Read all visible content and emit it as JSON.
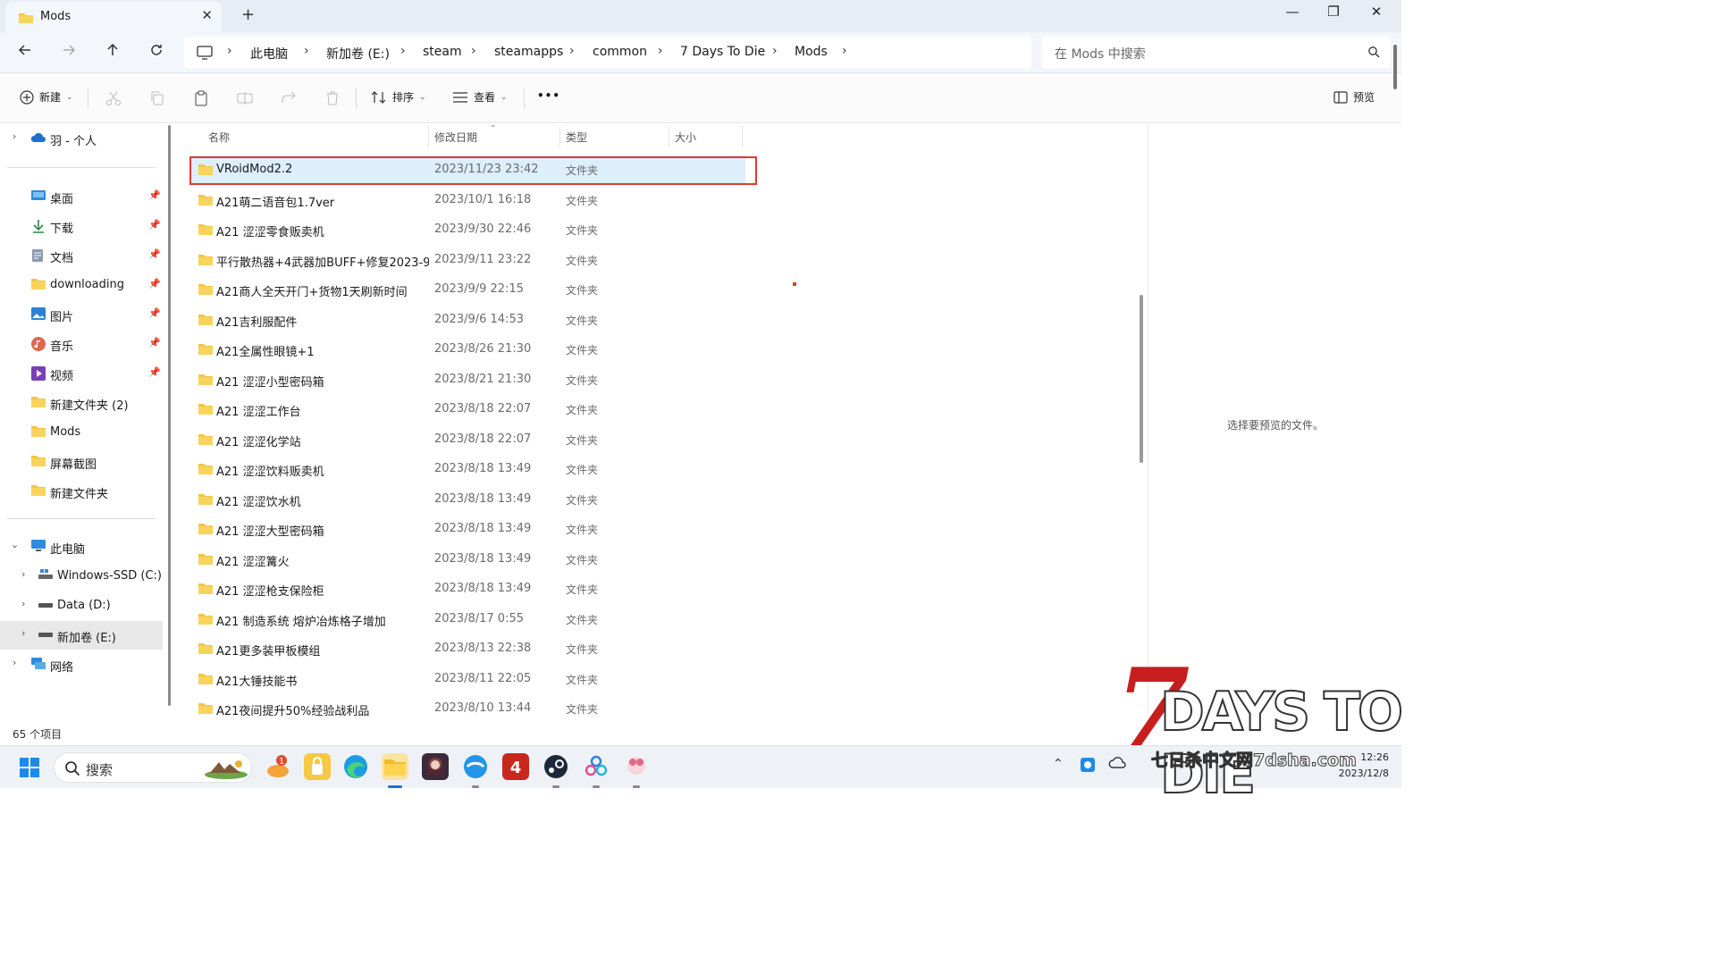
{
  "window": {
    "tab_title": "Mods",
    "controls": {
      "minimize": "—",
      "restore": "❐",
      "close": "✕"
    }
  },
  "nav": {
    "breadcrumbs": [
      "此电脑",
      "新加卷 (E:)",
      "steam",
      "steamapps",
      "common",
      "7 Days To Die",
      "Mods"
    ],
    "search_placeholder": "在 Mods 中搜索"
  },
  "toolbar": {
    "new_label": "新建",
    "sort_label": "排序",
    "view_label": "查看",
    "more_label": "•••",
    "preview_label": "预览"
  },
  "sidebar": {
    "top_item": "羽 - 个人",
    "quick": [
      {
        "label": "桌面",
        "icon": "desktop-icon",
        "pinned": true
      },
      {
        "label": "下载",
        "icon": "download-icon",
        "pinned": true
      },
      {
        "label": "文档",
        "icon": "documents-icon",
        "pinned": true
      },
      {
        "label": "downloading",
        "icon": "folder-icon",
        "pinned": true
      },
      {
        "label": "图片",
        "icon": "pictures-icon",
        "pinned": true
      },
      {
        "label": "音乐",
        "icon": "music-icon",
        "pinned": true
      },
      {
        "label": "视频",
        "icon": "videos-icon",
        "pinned": true
      },
      {
        "label": "新建文件夹 (2)",
        "icon": "folder-icon",
        "pinned": false
      },
      {
        "label": "Mods",
        "icon": "folder-icon",
        "pinned": false
      },
      {
        "label": "屏幕截图",
        "icon": "folder-icon",
        "pinned": false
      },
      {
        "label": "新建文件夹",
        "icon": "folder-icon",
        "pinned": false
      }
    ],
    "this_pc": "此电脑",
    "drives": [
      {
        "label": "Windows-SSD (C:)"
      },
      {
        "label": "Data (D:)"
      },
      {
        "label": "新加卷 (E:)",
        "selected": true
      }
    ],
    "network": "网络"
  },
  "columns": {
    "name": "名称",
    "date": "修改日期",
    "type": "类型",
    "size": "大小"
  },
  "files": [
    {
      "name": "VRoidMod2.2",
      "date": "2023/11/23 23:42",
      "type": "文件夹",
      "selected": true
    },
    {
      "name": "A21萌二语音包1.7ver",
      "date": "2023/10/1 16:18",
      "type": "文件夹"
    },
    {
      "name": "A21 涩涩零食贩卖机",
      "date": "2023/9/30 22:46",
      "type": "文件夹"
    },
    {
      "name": "平行散热器+4武器加BUFF+修复2023-9...",
      "date": "2023/9/11 23:22",
      "type": "文件夹"
    },
    {
      "name": "A21商人全天开门+货物1天刷新时间",
      "date": "2023/9/9 22:15",
      "type": "文件夹"
    },
    {
      "name": "A21吉利服配件",
      "date": "2023/9/6 14:53",
      "type": "文件夹"
    },
    {
      "name": "A21全属性眼镜+1",
      "date": "2023/8/26 21:30",
      "type": "文件夹"
    },
    {
      "name": "A21 涩涩小型密码箱",
      "date": "2023/8/21 21:30",
      "type": "文件夹"
    },
    {
      "name": "A21 涩涩工作台",
      "date": "2023/8/18 22:07",
      "type": "文件夹"
    },
    {
      "name": "A21 涩涩化学站",
      "date": "2023/8/18 22:07",
      "type": "文件夹"
    },
    {
      "name": "A21 涩涩饮料贩卖机",
      "date": "2023/8/18 13:49",
      "type": "文件夹"
    },
    {
      "name": "A21 涩涩饮水机",
      "date": "2023/8/18 13:49",
      "type": "文件夹"
    },
    {
      "name": "A21 涩涩大型密码箱",
      "date": "2023/8/18 13:49",
      "type": "文件夹"
    },
    {
      "name": "A21 涩涩篝火",
      "date": "2023/8/18 13:49",
      "type": "文件夹"
    },
    {
      "name": "A21 涩涩枪支保险柜",
      "date": "2023/8/18 13:49",
      "type": "文件夹"
    },
    {
      "name": "A21 制造系统 熔炉冶炼格子增加",
      "date": "2023/8/17 0:55",
      "type": "文件夹"
    },
    {
      "name": "A21更多装甲板模组",
      "date": "2023/8/13 22:38",
      "type": "文件夹"
    },
    {
      "name": "A21大锤技能书",
      "date": "2023/8/11 22:05",
      "type": "文件夹"
    },
    {
      "name": "A21夜间提升50%经验战利品",
      "date": "2023/8/10 13:44",
      "type": "文件夹"
    }
  ],
  "preview_message": "选择要预览的文件。",
  "status": {
    "item_count": "65 个项目"
  },
  "taskbar": {
    "search_label": "搜索",
    "notification_badge": "1",
    "clock_time": "12:26",
    "clock_date": "2023/12/8"
  },
  "watermark": {
    "seven": "7",
    "title": "DAYS TO DIE",
    "subtitle": "七日杀中文网7dsha.com"
  },
  "colors": {
    "accent": "#1f6fd1",
    "highlight_box": "#e03a2f",
    "selected_row": "#ddeefc",
    "folder_yellow": "#f4c542"
  }
}
